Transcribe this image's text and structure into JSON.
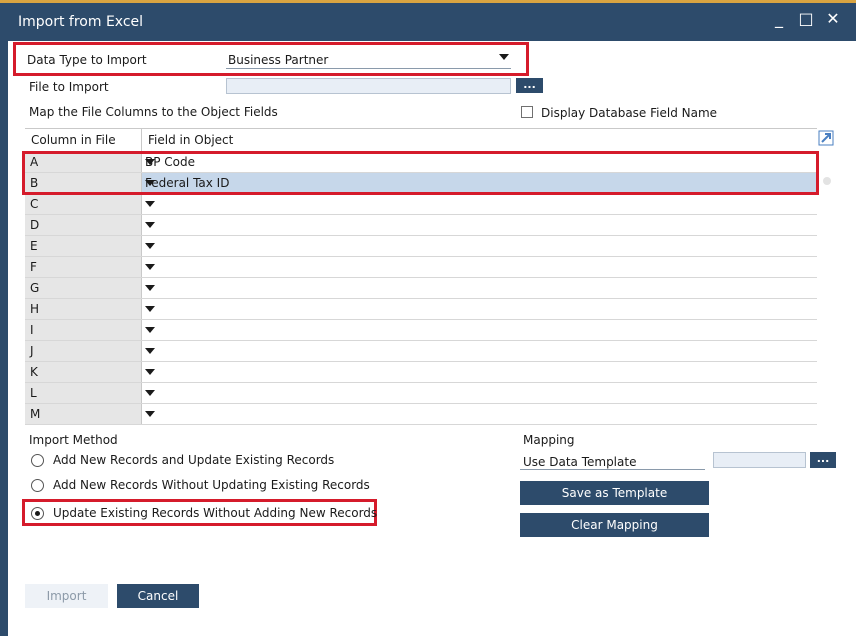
{
  "window": {
    "title": "Import from Excel",
    "minimize": "_",
    "maximize": "□",
    "close": "✕"
  },
  "form": {
    "data_type_label": "Data Type to Import",
    "data_type_value": "Business Partner",
    "file_to_import_label": "File to Import",
    "file_to_import_value": "",
    "browse_label": "...",
    "map_label": "Map the File Columns to the Object Fields",
    "display_db_field_label": "Display Database Field Name",
    "display_db_field_checked": false
  },
  "grid": {
    "headers": [
      "Column in File",
      "Field in Object"
    ],
    "rows": [
      {
        "col": "A",
        "field": "BP Code"
      },
      {
        "col": "B",
        "field": "Federal Tax ID"
      },
      {
        "col": "C",
        "field": ""
      },
      {
        "col": "D",
        "field": ""
      },
      {
        "col": "E",
        "field": ""
      },
      {
        "col": "F",
        "field": ""
      },
      {
        "col": "G",
        "field": ""
      },
      {
        "col": "H",
        "field": ""
      },
      {
        "col": "I",
        "field": ""
      },
      {
        "col": "J",
        "field": ""
      },
      {
        "col": "K",
        "field": ""
      },
      {
        "col": "L",
        "field": ""
      },
      {
        "col": "M",
        "field": ""
      }
    ]
  },
  "import_method": {
    "label": "Import Method",
    "options": [
      "Add New Records and Update Existing Records",
      "Add New Records Without Updating Existing Records",
      "Update Existing Records Without Adding New Records"
    ],
    "selected": 2
  },
  "mapping": {
    "label": "Mapping",
    "use_template_label": "Use Data Template",
    "template_value": "",
    "browse_label": "...",
    "save_template_label": "Save as Template",
    "clear_mapping_label": "Clear Mapping"
  },
  "footer": {
    "import_label": "Import",
    "cancel_label": "Cancel"
  },
  "colors": {
    "titlebar": "#2d4b6b",
    "accent_top": "#d9a441",
    "highlight_red": "#d51b2b",
    "selected_row": "#c6d7ea"
  }
}
